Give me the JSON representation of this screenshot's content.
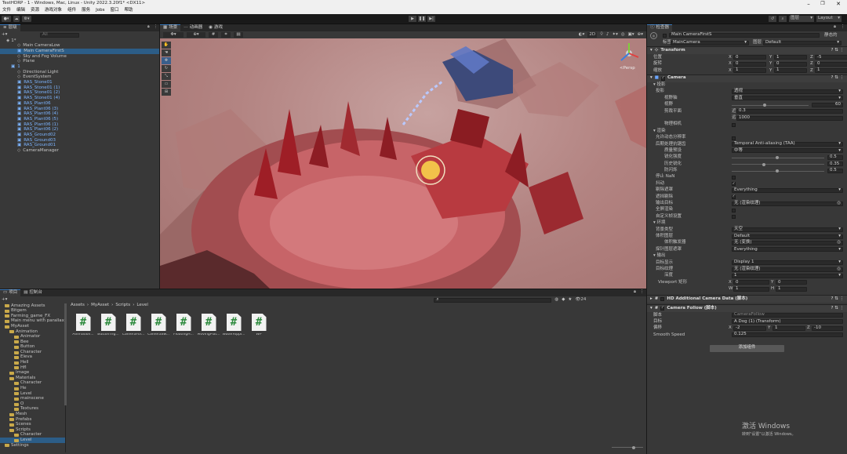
{
  "window": {
    "title": "TestHDRP - 1 - Windows, Mac, Linux - Unity 2022.3.20f1* <DX11>"
  },
  "menu": [
    "文件",
    "编辑",
    "资源",
    "游戏对象",
    "组件",
    "服务",
    "Jobs",
    "窗口",
    "帮助"
  ],
  "toolbar": {
    "layers": "图层",
    "layout": "Layout"
  },
  "hierarchy": {
    "tab": "层级",
    "search_placeholder": "All",
    "scene": "1*",
    "items": [
      {
        "label": "Main CameraLow",
        "indent": 2,
        "blue": false,
        "sel": false
      },
      {
        "label": "Main CameraFirstS",
        "indent": 2,
        "blue": true,
        "sel": true
      },
      {
        "label": "Sky and Fog Volume",
        "indent": 2,
        "blue": false,
        "sel": false
      },
      {
        "label": "Plane",
        "indent": 2,
        "blue": false,
        "sel": false
      },
      {
        "label": "1",
        "indent": 1,
        "blue": true,
        "sel": false
      },
      {
        "label": "Directional Light",
        "indent": 2,
        "blue": false,
        "sel": false
      },
      {
        "label": "EventSystem",
        "indent": 2,
        "blue": false,
        "sel": false
      },
      {
        "label": "RAS_Stone01",
        "indent": 2,
        "blue": true,
        "sel": false
      },
      {
        "label": "RAS_Stone01 (1)",
        "indent": 2,
        "blue": true,
        "sel": false
      },
      {
        "label": "RAS_Stone01 (2)",
        "indent": 2,
        "blue": true,
        "sel": false
      },
      {
        "label": "RAS_Stone01 (4)",
        "indent": 2,
        "blue": true,
        "sel": false
      },
      {
        "label": "RAS_Plant06",
        "indent": 2,
        "blue": true,
        "sel": false
      },
      {
        "label": "RAS_Plant06 (3)",
        "indent": 2,
        "blue": true,
        "sel": false
      },
      {
        "label": "RAS_Plant06 (4)",
        "indent": 2,
        "blue": true,
        "sel": false
      },
      {
        "label": "RAS_Plant06 (5)",
        "indent": 2,
        "blue": true,
        "sel": false
      },
      {
        "label": "RAS_Plant06 (1)",
        "indent": 2,
        "blue": true,
        "sel": false
      },
      {
        "label": "RAS_Plant06 (2)",
        "indent": 2,
        "blue": true,
        "sel": false
      },
      {
        "label": "RAS_Ground02",
        "indent": 2,
        "blue": true,
        "sel": false
      },
      {
        "label": "RAS_Ground03",
        "indent": 2,
        "blue": true,
        "sel": false
      },
      {
        "label": "RAS_Ground01",
        "indent": 2,
        "blue": true,
        "sel": false
      },
      {
        "label": "CameraManager",
        "indent": 2,
        "blue": false,
        "sel": false
      }
    ]
  },
  "scene": {
    "tabs": [
      "场景",
      "动画器",
      "游戏"
    ],
    "mode_2d": "2D",
    "persp": "<Persp"
  },
  "project": {
    "tabs": [
      "项目",
      "控制台"
    ],
    "breadcrumb": [
      "Assets",
      "MyAsset",
      "Scripts",
      "Level"
    ],
    "tree": [
      {
        "label": "Amazing Assets",
        "d": 1
      },
      {
        "label": "Bitgem",
        "d": 1
      },
      {
        "label": "Farming_game_FX",
        "d": 1
      },
      {
        "label": "Main menu with parallax",
        "d": 1
      },
      {
        "label": "MyAsset",
        "d": 1
      },
      {
        "label": "Animation",
        "d": 2
      },
      {
        "label": "Animator",
        "d": 3
      },
      {
        "label": "Bee",
        "d": 3
      },
      {
        "label": "Button",
        "d": 3
      },
      {
        "label": "Character",
        "d": 3
      },
      {
        "label": "Eleva",
        "d": 3
      },
      {
        "label": "Hell",
        "d": 3
      },
      {
        "label": "Hfl",
        "d": 3
      },
      {
        "label": "Image",
        "d": 2
      },
      {
        "label": "Materials",
        "d": 2
      },
      {
        "label": "Character",
        "d": 3
      },
      {
        "label": "He",
        "d": 3
      },
      {
        "label": "Level",
        "d": 3
      },
      {
        "label": "mainscene",
        "d": 3
      },
      {
        "label": "O",
        "d": 3
      },
      {
        "label": "Textures",
        "d": 3
      },
      {
        "label": "Mesh",
        "d": 2
      },
      {
        "label": "Prefabs",
        "d": 2
      },
      {
        "label": "Scenes",
        "d": 2
      },
      {
        "label": "Scripts",
        "d": 2
      },
      {
        "label": "Character",
        "d": 3
      },
      {
        "label": "Level",
        "d": 3
      },
      {
        "label": "Settings",
        "d": 1
      }
    ],
    "assets": [
      "Animation...",
      "ButtonTrig...",
      "CameraFol...",
      "CameraSw...",
      "FloatingH...",
      "MovingPlat...",
      "WaterRippl...",
      "WP"
    ],
    "count": "24"
  },
  "inspector": {
    "tab": "检查器",
    "object_name": "Main CameraFirstS",
    "static": "静态的",
    "tag_label": "标签",
    "tag": "MainCamera",
    "layer_label": "图层",
    "layer": "Default",
    "transform": {
      "title": "Transform",
      "rows": [
        {
          "label": "位置",
          "x": "0",
          "y": "1",
          "z": "-5"
        },
        {
          "label": "旋转",
          "x": "0",
          "y": "0",
          "z": "0"
        },
        {
          "label": "缩放",
          "x": "1",
          "y": "1",
          "z": "1"
        }
      ]
    },
    "camera": {
      "title": "Camera",
      "projection_header": "投影",
      "projection_label": "投影",
      "projection": "透视",
      "fov_axis_label": "视野轴",
      "fov_axis": "垂直",
      "fov_label": "视野",
      "fov": "60",
      "clip_label": "剪裁平面",
      "near_label": "近",
      "near": "0.3",
      "far_label": "远",
      "far": "1000",
      "physical_label": "物理相机",
      "rendering_header": "渲染",
      "r_rows": [
        {
          "label": "允许动态分辨率",
          "kind": "chk",
          "val": ""
        },
        {
          "label": "后期处理抗锯齿",
          "kind": "drop",
          "val": "Temporal Anti-aliasing (TAA)"
        },
        {
          "label": "质量预设",
          "kind": "drop",
          "val": "中等"
        },
        {
          "label": "锐化强度",
          "kind": "slider",
          "val": "0.5"
        },
        {
          "label": "历史锐化",
          "kind": "slider",
          "val": "0.35"
        },
        {
          "label": "防闪烁",
          "kind": "slider",
          "val": "0.5"
        },
        {
          "label": "停止 NaN",
          "kind": "chk",
          "val": ""
        },
        {
          "label": "抖动",
          "kind": "chk",
          "val": "✓"
        },
        {
          "label": "剔除遮罩",
          "kind": "drop",
          "val": "Everything"
        },
        {
          "label": "遮挡剔除",
          "kind": "chk",
          "val": "✓"
        },
        {
          "label": "输出目标",
          "kind": "obj",
          "val": "无 (渲染纹理)"
        },
        {
          "label": "全屏渲染",
          "kind": "chk",
          "val": ""
        },
        {
          "label": "自定义帧设置",
          "kind": "chk",
          "val": ""
        }
      ],
      "environment_header": "环境",
      "e_rows": [
        {
          "label": "背景类型",
          "val": "天空"
        },
        {
          "label": "体积图层",
          "val": "Default"
        },
        {
          "label": "体积触发器",
          "val": "无 (变换)"
        },
        {
          "label": "探针图层遮罩",
          "val": "Everything"
        }
      ],
      "output_header": "输出",
      "o_rows": [
        {
          "label": "目标显示",
          "val": "Display 1"
        },
        {
          "label": "目标纹理",
          "val": "无 (渲染纹理)"
        },
        {
          "label": "深度",
          "val": "1"
        }
      ],
      "viewport": {
        "label": "Viewport 矩形",
        "x": "0",
        "y": "0",
        "w": "1",
        "h": "1"
      }
    },
    "hd_data": "HD Additional Camera Data   (脚本)",
    "follow": {
      "title": "Camera Follow   (脚本)",
      "script_label": "脚本",
      "script": "CameraFollow",
      "target_label": "目标",
      "target": "A Dog (1) (Transform)",
      "offset_label": "偏移",
      "ox": "-2",
      "oy": "1",
      "oz": "-10",
      "speed_label": "Smooth Speed",
      "speed": "0.125"
    },
    "add_component": "添加组件"
  },
  "watermark": {
    "title": "激活 Windows",
    "sub": "转到\"设置\"以激活 Windows。"
  }
}
